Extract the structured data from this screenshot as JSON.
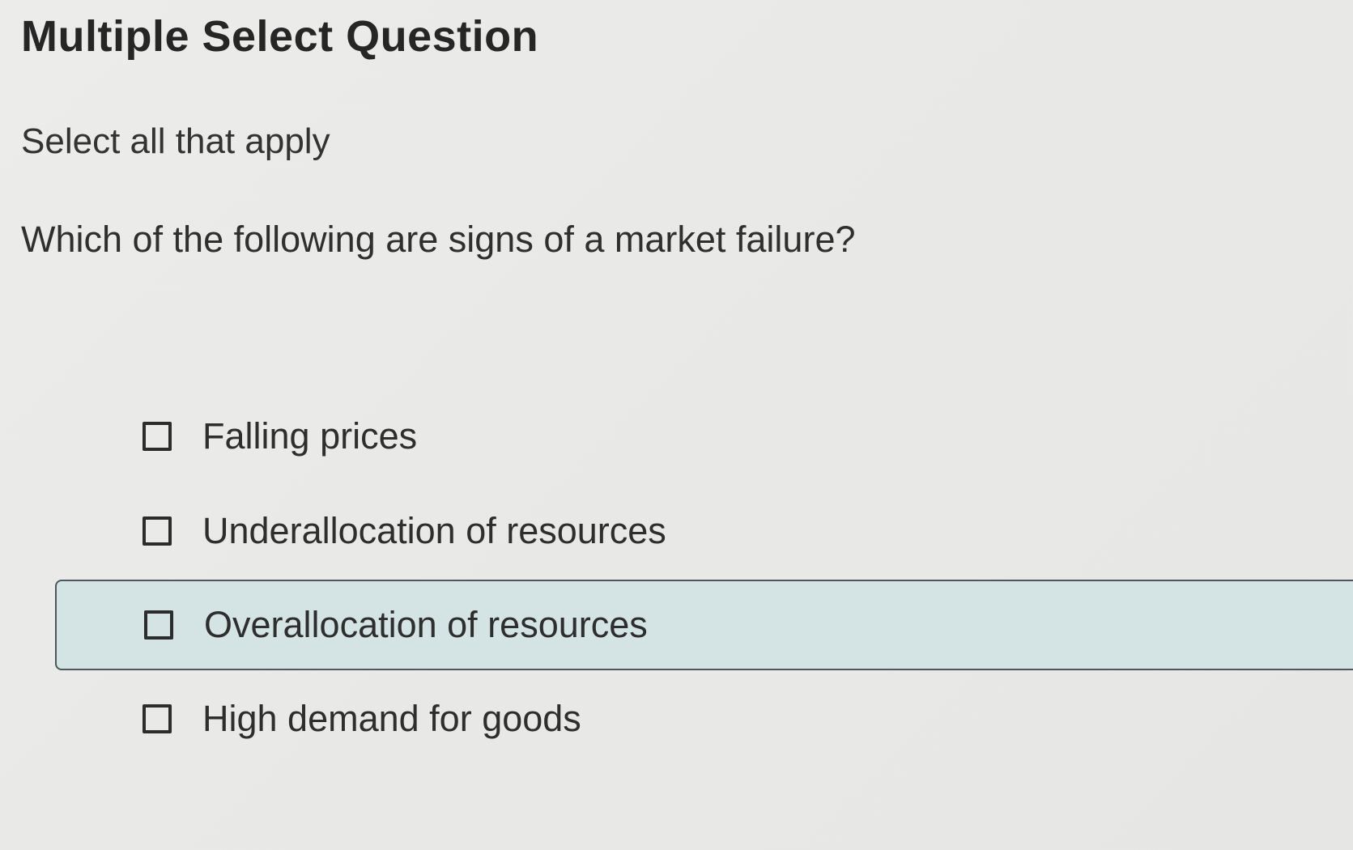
{
  "header": {
    "title": "Multiple Select Question"
  },
  "instruction": "Select all that apply",
  "question": "Which of the following are signs of a market failure?",
  "options": [
    {
      "label": "Falling prices",
      "checked": false,
      "highlighted": false
    },
    {
      "label": "Underallocation of resources",
      "checked": false,
      "highlighted": false
    },
    {
      "label": "Overallocation of resources",
      "checked": false,
      "highlighted": true
    },
    {
      "label": "High demand for goods",
      "checked": false,
      "highlighted": false
    }
  ],
  "colors": {
    "highlight_background": "#d4e3e3",
    "highlight_border": "#4a5a5c",
    "text": "#2e2e2e",
    "page_background": "#ebebe9"
  }
}
